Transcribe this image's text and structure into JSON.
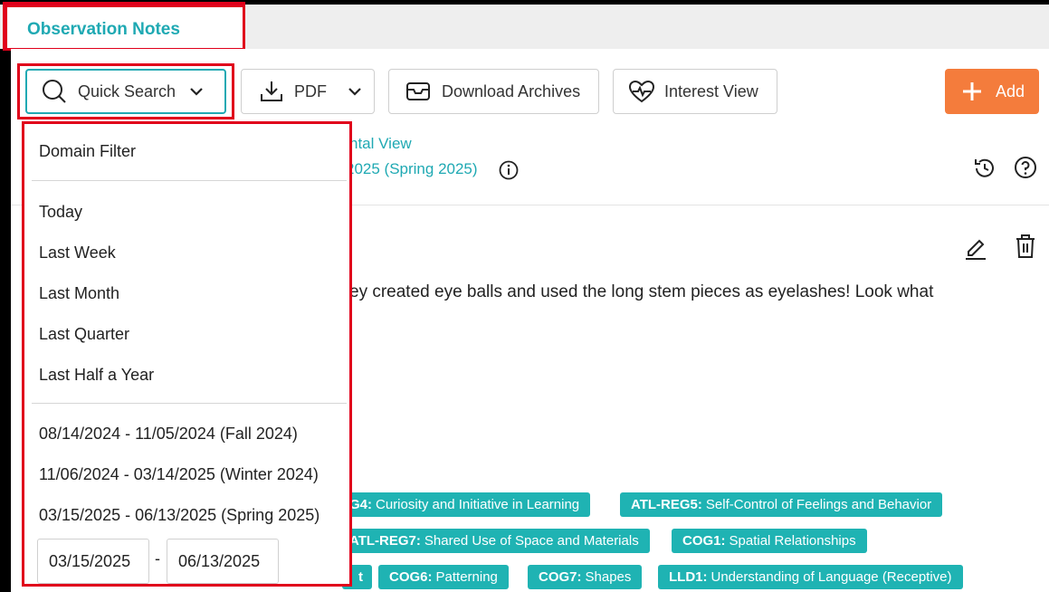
{
  "tab": {
    "title": "Observation Notes"
  },
  "toolbar": {
    "quick_search": "Quick Search",
    "pdf": "PDF",
    "download_archives": "Download Archives",
    "interest_view": "Interest View",
    "add": "Add"
  },
  "background": {
    "view_link": "ntal View",
    "period_link": "2025 (Spring 2025)",
    "note_text": "ey created eye balls and used the long stem pieces as eyelashes! Look what"
  },
  "chips": [
    {
      "code": "G4:",
      "label": "Curiosity and Initiative in Learning"
    },
    {
      "code": "ATL-REG5:",
      "label": "Self-Control of Feelings and Behavior"
    },
    {
      "code": "ATL-REG7:",
      "label": "Shared Use of Space and Materials"
    },
    {
      "code": "COG1:",
      "label": "Spatial Relationships"
    },
    {
      "code": "t",
      "label": ""
    },
    {
      "code": "COG6:",
      "label": "Patterning"
    },
    {
      "code": "COG7:",
      "label": "Shapes"
    },
    {
      "code": "LLD1:",
      "label": "Understanding of Language (Receptive)"
    }
  ],
  "dropdown": {
    "domain_filter": "Domain Filter",
    "today": "Today",
    "last_week": "Last Week",
    "last_month": "Last Month",
    "last_quarter": "Last Quarter",
    "last_half_year": "Last Half a Year",
    "ranges": [
      "08/14/2024 - 11/05/2024 (Fall 2024)",
      "11/06/2024 - 03/14/2025 (Winter 2024)",
      "03/15/2025 - 06/13/2025 (Spring 2025)"
    ],
    "start_date": "03/15/2025",
    "date_separator": "-",
    "end_date": "06/13/2025"
  },
  "colors": {
    "accent": "#1fa9b3",
    "add": "#f47c3c",
    "highlight": "#e0001b"
  },
  "icons": [
    "search-icon",
    "chevron-down-icon",
    "download-icon",
    "archive-icon",
    "heart-pulse-icon",
    "plus-icon",
    "info-icon",
    "history-icon",
    "help-icon",
    "edit-icon",
    "trash-icon"
  ]
}
